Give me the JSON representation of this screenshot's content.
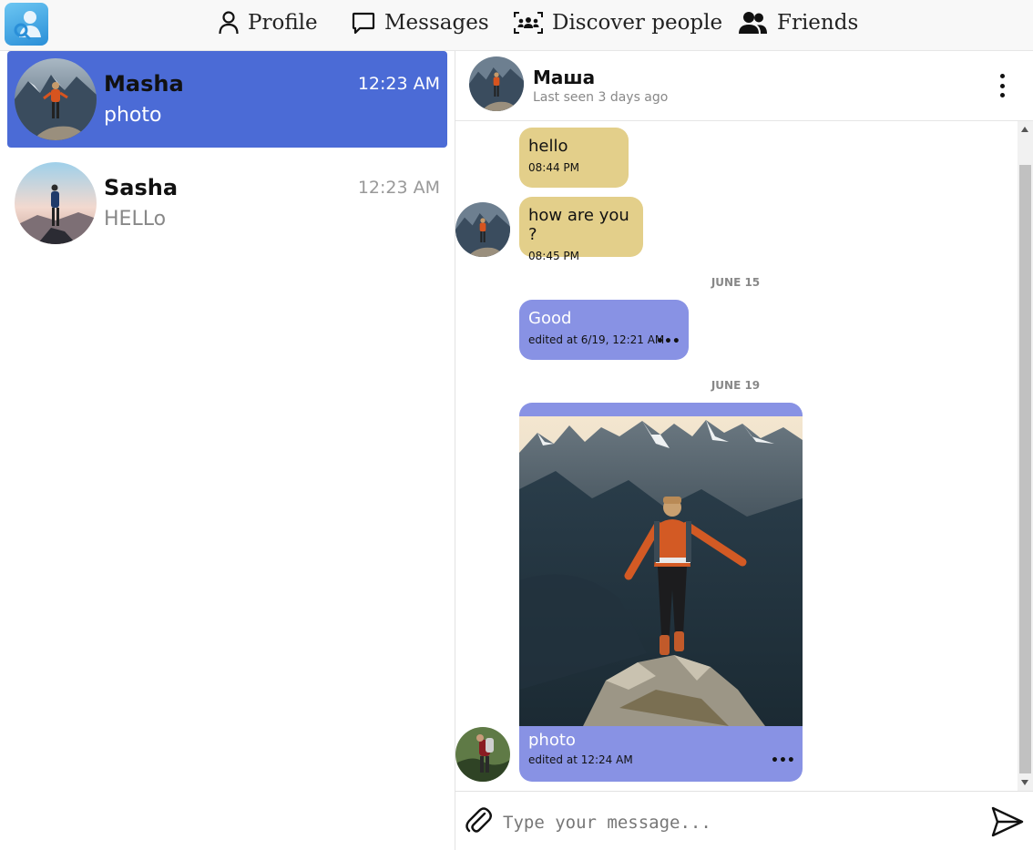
{
  "nav": {
    "profile": "Profile",
    "messages": "Messages",
    "discover": "Discover people",
    "friends": "Friends"
  },
  "chats": [
    {
      "name": "Masha",
      "time": "12:23 AM",
      "preview": "photo",
      "active": true
    },
    {
      "name": "Sasha",
      "time": "12:23 AM",
      "preview": "HELLo",
      "active": false
    }
  ],
  "conversation": {
    "name": "Маша",
    "status": "Last seen 3 days ago"
  },
  "messages": [
    {
      "text": "hello",
      "meta": "08:44 PM",
      "direction": "in"
    },
    {
      "text": "how are you ?",
      "meta": "08:45 PM",
      "direction": "in"
    },
    {
      "date": "JUNE 15"
    },
    {
      "text": "Good",
      "meta": "edited at 6/19, 12:21 AM",
      "direction": "out",
      "menu": "•••"
    },
    {
      "date": "JUNE 19"
    },
    {
      "text": "photo",
      "meta": "edited at 12:24 AM",
      "direction": "out",
      "menu": "•••",
      "has_photo": true
    }
  ],
  "composer": {
    "placeholder": "Type your message..."
  },
  "colors": {
    "active_chat": "#4b6bd6",
    "incoming_bubble": "#e3cf8a",
    "outgoing_bubble": "#8892e4"
  },
  "icons": [
    "user-icon",
    "chat-bubble-icon",
    "people-group-icon",
    "friends-icon",
    "paperclip-icon",
    "send-icon",
    "more-vertical-icon"
  ]
}
